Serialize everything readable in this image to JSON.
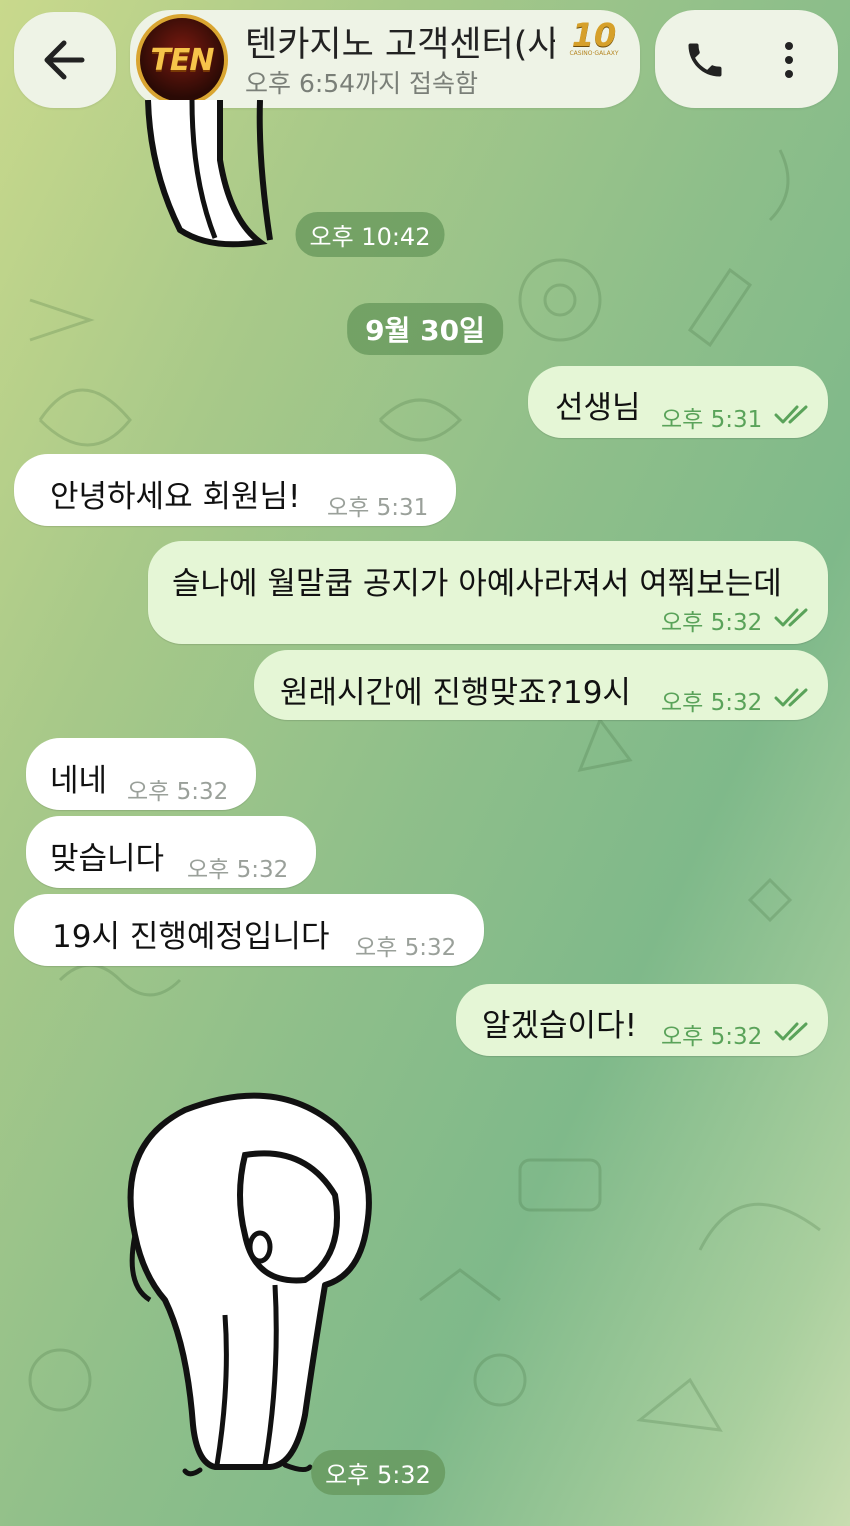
{
  "header": {
    "title": "텐카지노 고객센터(사",
    "subtitle": "오후 6:54까지 접속함",
    "avatar_text": "TEN",
    "badge_number": "10",
    "badge_text": "CASINO·GALAXY"
  },
  "timestamps": {
    "top_sticker_time": "오후 10:42",
    "bottom_sticker_time": "오후 5:32"
  },
  "date_separator": "9월 30일",
  "messages": [
    {
      "dir": "out",
      "text": "선생님",
      "time": "오후 5:31"
    },
    {
      "dir": "in",
      "text": "안녕하세요 회원님!",
      "time": "오후 5:31"
    },
    {
      "dir": "out",
      "text": "슬나에 월말쿱 공지가 아예사라져서 여쭤보는데",
      "time": "오후 5:32"
    },
    {
      "dir": "out",
      "text": "원래시간에 진행맞죠?19시",
      "time": "오후 5:32"
    },
    {
      "dir": "in",
      "text": "네네",
      "time": "오후 5:32"
    },
    {
      "dir": "in",
      "text": "맞습니다",
      "time": "오후 5:32"
    },
    {
      "dir": "in",
      "text": "19시 진행예정입니다",
      "time": "오후 5:32"
    },
    {
      "dir": "out",
      "text": "알겠습이다!",
      "time": "오후 5:32"
    }
  ],
  "icons": [
    "back-arrow-icon",
    "phone-icon",
    "more-vertical-icon",
    "double-check-icon"
  ],
  "colors": {
    "outgoing_bubble": "#e5f6d6",
    "incoming_bubble": "#ffffff",
    "read_check": "#5aa35a"
  }
}
